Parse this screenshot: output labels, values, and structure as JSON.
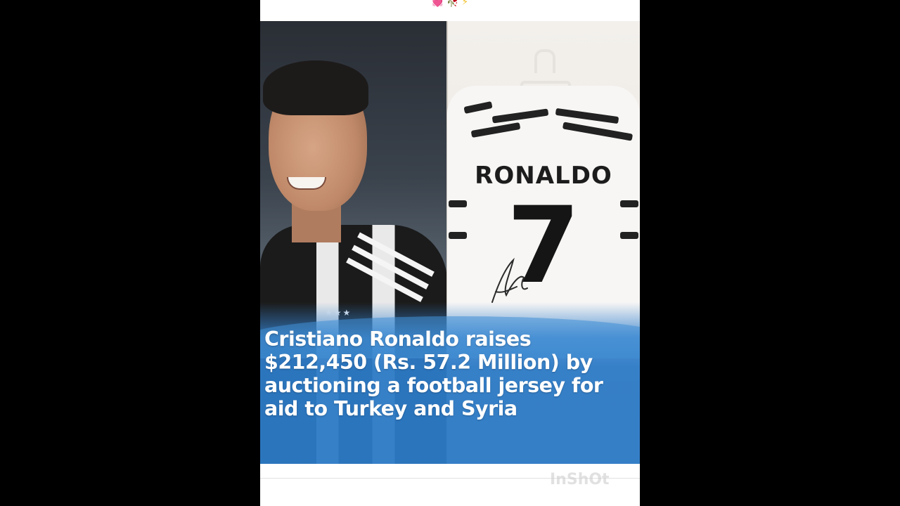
{
  "top_emojis": [
    {
      "icon": "balloon-heart-icon",
      "glyph": "💓"
    },
    {
      "icon": "rose-icon",
      "glyph": "🥀"
    },
    {
      "icon": "lightning-icon",
      "glyph": "⚡"
    }
  ],
  "jersey": {
    "name": "RONALDO",
    "number": "7"
  },
  "caption": "Cristiano Ronaldo raises\n$212,450 (Rs. 57.2 Million) by\nauctioning a football jersey for\naid to Turkey and Syria",
  "watermark": "InShOt",
  "colors": {
    "background": "#000000",
    "card": "#ffffff",
    "caption_blue": "#2c7ac6",
    "caption_text": "#ffffff"
  }
}
